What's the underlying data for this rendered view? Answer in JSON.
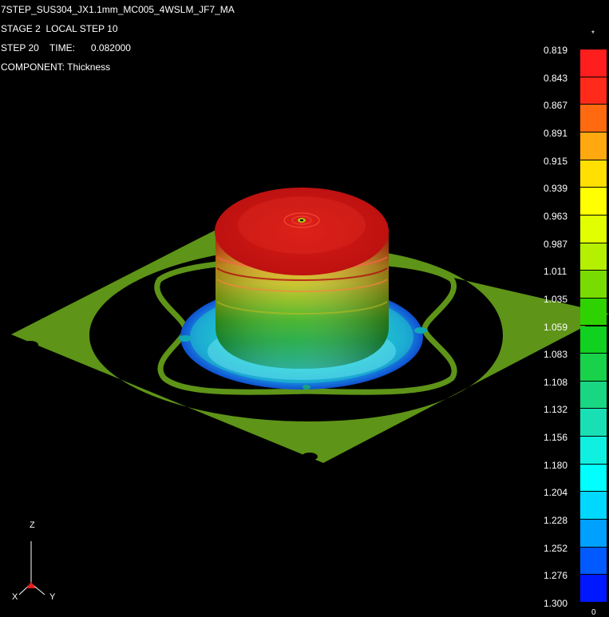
{
  "header": {
    "model": "7STEP_SUS304_JX1.1mm_MC005_4WSLM_JF7_MA",
    "stage": "STAGE 2  LOCAL STEP 10",
    "step": "STEP 20    TIME:      0.082000",
    "component": "COMPONENT: Thickness"
  },
  "legend": {
    "top_mark": "*",
    "bottom_mark": "0",
    "ticks": [
      "0.819",
      "0.843",
      "0.867",
      "0.891",
      "0.915",
      "0.939",
      "0.963",
      "0.987",
      "1.011",
      "1.035",
      "1.059",
      "1.083",
      "1.108",
      "1.132",
      "1.156",
      "1.180",
      "1.204",
      "1.228",
      "1.252",
      "1.276",
      "1.300"
    ],
    "colors": [
      "#ff1e1e",
      "#ff2a1a",
      "#ff6a10",
      "#ffa810",
      "#ffe000",
      "#ffff00",
      "#e2ff00",
      "#b4f000",
      "#78dc00",
      "#2ed200",
      "#10d020",
      "#18d24a",
      "#18d682",
      "#18e0b4",
      "#10f0e0",
      "#00ffff",
      "#00d8ff",
      "#00a0ff",
      "#005aff",
      "#0018ff"
    ]
  },
  "triad": {
    "z_label": "Z",
    "x_label": "X",
    "y_label": "Y"
  }
}
